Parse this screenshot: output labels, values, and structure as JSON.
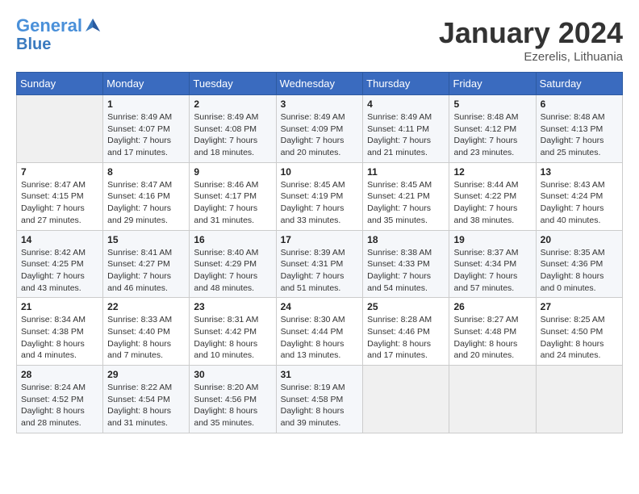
{
  "header": {
    "logo_line1": "General",
    "logo_line2": "Blue",
    "month": "January 2024",
    "location": "Ezerelis, Lithuania"
  },
  "days_of_week": [
    "Sunday",
    "Monday",
    "Tuesday",
    "Wednesday",
    "Thursday",
    "Friday",
    "Saturday"
  ],
  "weeks": [
    [
      {
        "day": "",
        "sunrise": "",
        "sunset": "",
        "daylight": ""
      },
      {
        "day": "1",
        "sunrise": "Sunrise: 8:49 AM",
        "sunset": "Sunset: 4:07 PM",
        "daylight": "Daylight: 7 hours and 17 minutes."
      },
      {
        "day": "2",
        "sunrise": "Sunrise: 8:49 AM",
        "sunset": "Sunset: 4:08 PM",
        "daylight": "Daylight: 7 hours and 18 minutes."
      },
      {
        "day": "3",
        "sunrise": "Sunrise: 8:49 AM",
        "sunset": "Sunset: 4:09 PM",
        "daylight": "Daylight: 7 hours and 20 minutes."
      },
      {
        "day": "4",
        "sunrise": "Sunrise: 8:49 AM",
        "sunset": "Sunset: 4:11 PM",
        "daylight": "Daylight: 7 hours and 21 minutes."
      },
      {
        "day": "5",
        "sunrise": "Sunrise: 8:48 AM",
        "sunset": "Sunset: 4:12 PM",
        "daylight": "Daylight: 7 hours and 23 minutes."
      },
      {
        "day": "6",
        "sunrise": "Sunrise: 8:48 AM",
        "sunset": "Sunset: 4:13 PM",
        "daylight": "Daylight: 7 hours and 25 minutes."
      }
    ],
    [
      {
        "day": "7",
        "sunrise": "Sunrise: 8:47 AM",
        "sunset": "Sunset: 4:15 PM",
        "daylight": "Daylight: 7 hours and 27 minutes."
      },
      {
        "day": "8",
        "sunrise": "Sunrise: 8:47 AM",
        "sunset": "Sunset: 4:16 PM",
        "daylight": "Daylight: 7 hours and 29 minutes."
      },
      {
        "day": "9",
        "sunrise": "Sunrise: 8:46 AM",
        "sunset": "Sunset: 4:17 PM",
        "daylight": "Daylight: 7 hours and 31 minutes."
      },
      {
        "day": "10",
        "sunrise": "Sunrise: 8:45 AM",
        "sunset": "Sunset: 4:19 PM",
        "daylight": "Daylight: 7 hours and 33 minutes."
      },
      {
        "day": "11",
        "sunrise": "Sunrise: 8:45 AM",
        "sunset": "Sunset: 4:21 PM",
        "daylight": "Daylight: 7 hours and 35 minutes."
      },
      {
        "day": "12",
        "sunrise": "Sunrise: 8:44 AM",
        "sunset": "Sunset: 4:22 PM",
        "daylight": "Daylight: 7 hours and 38 minutes."
      },
      {
        "day": "13",
        "sunrise": "Sunrise: 8:43 AM",
        "sunset": "Sunset: 4:24 PM",
        "daylight": "Daylight: 7 hours and 40 minutes."
      }
    ],
    [
      {
        "day": "14",
        "sunrise": "Sunrise: 8:42 AM",
        "sunset": "Sunset: 4:25 PM",
        "daylight": "Daylight: 7 hours and 43 minutes."
      },
      {
        "day": "15",
        "sunrise": "Sunrise: 8:41 AM",
        "sunset": "Sunset: 4:27 PM",
        "daylight": "Daylight: 7 hours and 46 minutes."
      },
      {
        "day": "16",
        "sunrise": "Sunrise: 8:40 AM",
        "sunset": "Sunset: 4:29 PM",
        "daylight": "Daylight: 7 hours and 48 minutes."
      },
      {
        "day": "17",
        "sunrise": "Sunrise: 8:39 AM",
        "sunset": "Sunset: 4:31 PM",
        "daylight": "Daylight: 7 hours and 51 minutes."
      },
      {
        "day": "18",
        "sunrise": "Sunrise: 8:38 AM",
        "sunset": "Sunset: 4:33 PM",
        "daylight": "Daylight: 7 hours and 54 minutes."
      },
      {
        "day": "19",
        "sunrise": "Sunrise: 8:37 AM",
        "sunset": "Sunset: 4:34 PM",
        "daylight": "Daylight: 7 hours and 57 minutes."
      },
      {
        "day": "20",
        "sunrise": "Sunrise: 8:35 AM",
        "sunset": "Sunset: 4:36 PM",
        "daylight": "Daylight: 8 hours and 0 minutes."
      }
    ],
    [
      {
        "day": "21",
        "sunrise": "Sunrise: 8:34 AM",
        "sunset": "Sunset: 4:38 PM",
        "daylight": "Daylight: 8 hours and 4 minutes."
      },
      {
        "day": "22",
        "sunrise": "Sunrise: 8:33 AM",
        "sunset": "Sunset: 4:40 PM",
        "daylight": "Daylight: 8 hours and 7 minutes."
      },
      {
        "day": "23",
        "sunrise": "Sunrise: 8:31 AM",
        "sunset": "Sunset: 4:42 PM",
        "daylight": "Daylight: 8 hours and 10 minutes."
      },
      {
        "day": "24",
        "sunrise": "Sunrise: 8:30 AM",
        "sunset": "Sunset: 4:44 PM",
        "daylight": "Daylight: 8 hours and 13 minutes."
      },
      {
        "day": "25",
        "sunrise": "Sunrise: 8:28 AM",
        "sunset": "Sunset: 4:46 PM",
        "daylight": "Daylight: 8 hours and 17 minutes."
      },
      {
        "day": "26",
        "sunrise": "Sunrise: 8:27 AM",
        "sunset": "Sunset: 4:48 PM",
        "daylight": "Daylight: 8 hours and 20 minutes."
      },
      {
        "day": "27",
        "sunrise": "Sunrise: 8:25 AM",
        "sunset": "Sunset: 4:50 PM",
        "daylight": "Daylight: 8 hours and 24 minutes."
      }
    ],
    [
      {
        "day": "28",
        "sunrise": "Sunrise: 8:24 AM",
        "sunset": "Sunset: 4:52 PM",
        "daylight": "Daylight: 8 hours and 28 minutes."
      },
      {
        "day": "29",
        "sunrise": "Sunrise: 8:22 AM",
        "sunset": "Sunset: 4:54 PM",
        "daylight": "Daylight: 8 hours and 31 minutes."
      },
      {
        "day": "30",
        "sunrise": "Sunrise: 8:20 AM",
        "sunset": "Sunset: 4:56 PM",
        "daylight": "Daylight: 8 hours and 35 minutes."
      },
      {
        "day": "31",
        "sunrise": "Sunrise: 8:19 AM",
        "sunset": "Sunset: 4:58 PM",
        "daylight": "Daylight: 8 hours and 39 minutes."
      },
      {
        "day": "",
        "sunrise": "",
        "sunset": "",
        "daylight": ""
      },
      {
        "day": "",
        "sunrise": "",
        "sunset": "",
        "daylight": ""
      },
      {
        "day": "",
        "sunrise": "",
        "sunset": "",
        "daylight": ""
      }
    ]
  ]
}
